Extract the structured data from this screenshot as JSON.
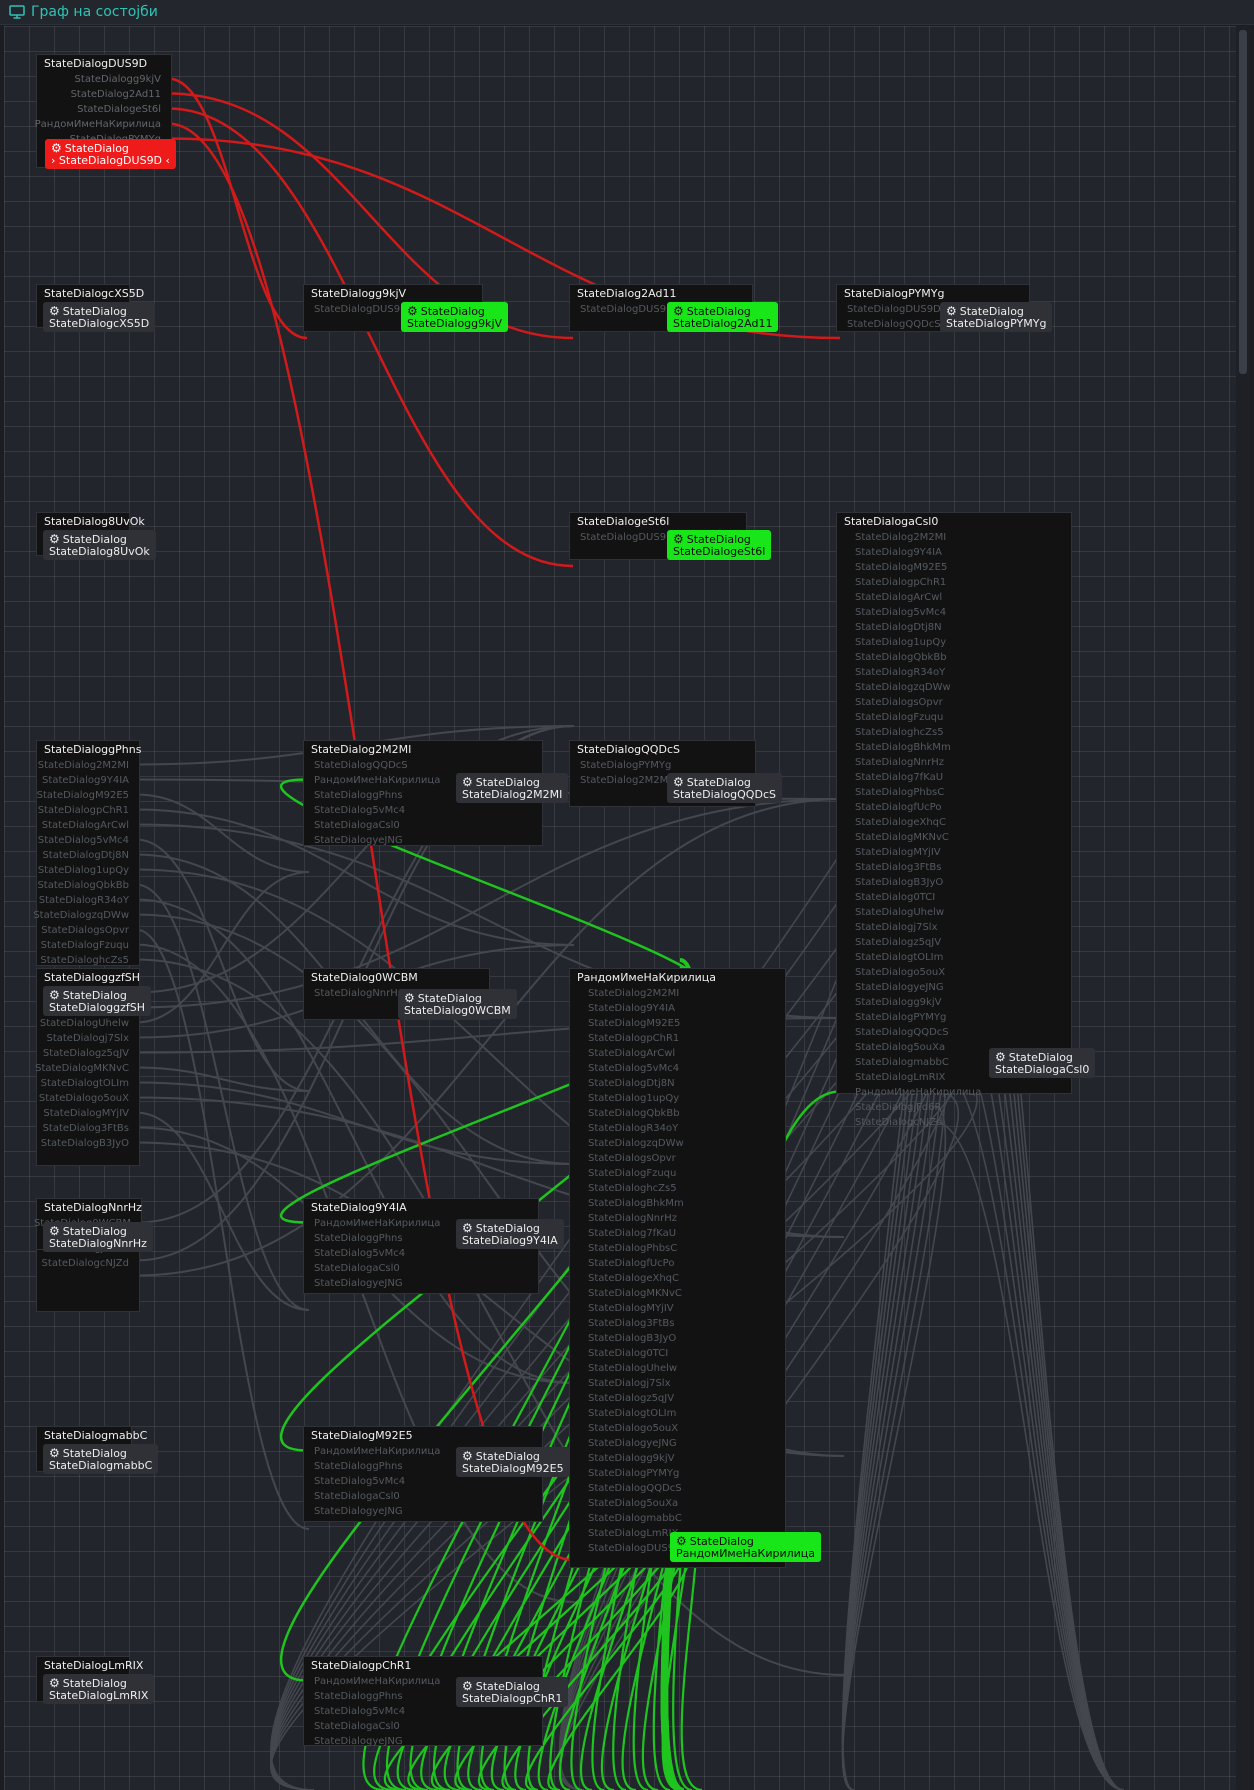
{
  "window": {
    "title": "Граф на состојби"
  },
  "colors": {
    "accent": "#2ec4b6",
    "active_edge": "#d11a1a",
    "reachable_edge": "#1fc41f",
    "idle_edge": "#44474d",
    "current_badge": "#ef1b1b",
    "reachable_badge": "#19e619",
    "idle_badge": "#2f3136"
  },
  "badge_prefix": "StateDialog",
  "nodes": {
    "dus9d": {
      "title": "StateDialogDUS9D",
      "ports": [
        "StateDialogg9kjV",
        "StateDialog2Ad11",
        "StateDialogeSt6l",
        "РандомИмеНаКирилица",
        "StateDialogPYMYg"
      ],
      "badge": "StateDialogDUS9D"
    },
    "xs5d": {
      "title": "StateDialogcXS5D",
      "ports": [],
      "badge": "StateDialogcXS5D"
    },
    "g9kjv": {
      "title": "StateDialogg9kjV",
      "ports": [
        "StateDialogDUS9D"
      ],
      "badge": "StateDialogg9kjV"
    },
    "ad11": {
      "title": "StateDialog2Ad11",
      "ports": [
        "StateDialogDUS9D"
      ],
      "badge": "StateDialog2Ad11"
    },
    "pymyg": {
      "title": "StateDialogPYMYg",
      "ports": [
        "StateDialogDUS9D",
        "StateDialogQQDcS"
      ],
      "badge": "StateDialogPYMYg"
    },
    "uvok": {
      "title": "StateDialog8UvOk",
      "ports": [],
      "badge": "StateDialog8UvOk"
    },
    "est6l": {
      "title": "StateDialogeSt6l",
      "ports": [
        "StateDialogDUS9D"
      ],
      "badge": "StateDialogeSt6l"
    },
    "acsl0": {
      "title": "StateDialogaCsl0",
      "ports": [
        "StateDialog2M2MI",
        "StateDialog9Y4IA",
        "StateDialogM92E5",
        "StateDialogpChR1",
        "StateDialogArCwl",
        "StateDialog5vMc4",
        "StateDialogDtj8N",
        "StateDialog1upQy",
        "StateDialogQbkBb",
        "StateDialogR34oY",
        "StateDialogzqDWw",
        "StateDialogsOpvr",
        "StateDialogFzuqu",
        "StateDialoghcZs5",
        "StateDialogBhkMm",
        "StateDialogNnrHz",
        "StateDialog7fKaU",
        "StateDialogPhbsC",
        "StateDialogfUcPo",
        "StateDialogeXhqC",
        "StateDialogMKNvC",
        "StateDialogMYjIV",
        "StateDialog3FtBs",
        "StateDialogB3JyO",
        "StateDialog0TCI",
        "StateDialogUhelw",
        "StateDialogj7Slx",
        "StateDialogz5qJV",
        "StateDialogtOLIm",
        "StateDialogo5ouX",
        "StateDialogyeJNG",
        "StateDialogg9kjV",
        "StateDialogPYMYg",
        "StateDialogQQDcS",
        "StateDialog5ouXa",
        "StateDialogmabbC",
        "StateDialogLmRIX",
        "РандомИмеНаКирилица",
        "StateDialogjFd6R",
        "StateDialogcNJZd"
      ],
      "badge": "StateDialogaCsl0"
    },
    "phns": {
      "title": "StateDialoggPhns",
      "ports": [
        "StateDialog2M2MI",
        "StateDialog9Y4IA",
        "StateDialogM92E5",
        "StateDialogpChR1",
        "StateDialogArCwl",
        "StateDialog5vMc4",
        "StateDialogDtj8N",
        "StateDialog1upQy",
        "StateDialogQbkBb",
        "StateDialogR34oY",
        "StateDialogzqDWw",
        "StateDialogsOpvr",
        "StateDialogFzuqu",
        "StateDialoghcZs5"
      ],
      "badge": "StateDialoggPhns"
    },
    "phns_tail": {
      "ports": [
        "StateDialogjFd6R",
        "StateDialogcNJZd"
      ]
    },
    "m2mi": {
      "title": "StateDialog2M2MI",
      "ports": [
        "StateDialogQQDcS",
        "РандомИмеНаКирилица",
        "StateDialoggPhns",
        "StateDialog5vMc4",
        "StateDialogaCsl0",
        "StateDialogyeJNG"
      ],
      "badge": "StateDialog2M2MI"
    },
    "qqdcs": {
      "title": "StateDialogQQDcS",
      "ports": [
        "StateDialogPYMYg",
        "StateDialog2M2MI"
      ],
      "badge": "StateDialogQQDcS"
    },
    "gzfsh": {
      "title": "StateDialoggzfSH",
      "ports": [
        "StateDialogo0TCI",
        "StateDialogaCsl0",
        "StateDialogUhelw",
        "StateDialogj7Slx",
        "StateDialogz5qJV",
        "StateDialogMKNvC",
        "StateDialogtOLIm",
        "StateDialogo5ouX",
        "StateDialogMYjIV",
        "StateDialog3FtBs",
        "StateDialogB3JyO"
      ],
      "badge": "StateDialoggzfSH"
    },
    "wcbm": {
      "title": "StateDialog0WCBM",
      "ports": [
        "StateDialogNnrHz"
      ],
      "badge": "StateDialog0WCBM"
    },
    "kir": {
      "title": "РандомИмеНаКирилица",
      "ports": [
        "StateDialog2M2MI",
        "StateDialog9Y4IA",
        "StateDialogM92E5",
        "StateDialogpChR1",
        "StateDialogArCwl",
        "StateDialog5vMc4",
        "StateDialogDtj8N",
        "StateDialog1upQy",
        "StateDialogQbkBb",
        "StateDialogR34oY",
        "StateDialogzqDWw",
        "StateDialogsOpvr",
        "StateDialogFzuqu",
        "StateDialoghcZs5",
        "StateDialogBhkMm",
        "StateDialogNnrHz",
        "StateDialog7fKaU",
        "StateDialogPhbsC",
        "StateDialogfUcPo",
        "StateDialogeXhqC",
        "StateDialogMKNvC",
        "StateDialogMYjIV",
        "StateDialog3FtBs",
        "StateDialogB3JyO",
        "StateDialog0TCI",
        "StateDialogUhelw",
        "StateDialogj7Slx",
        "StateDialogz5qJV",
        "StateDialogtOLIm",
        "StateDialogo5ouX",
        "StateDialogyeJNG",
        "StateDialogg9kjV",
        "StateDialogPYMYg",
        "StateDialogQQDcS",
        "StateDialog5ouXa",
        "StateDialogmabbC",
        "StateDialogLmRIX",
        "StateDialogDUS9D"
      ],
      "badge": "РандомИмеНаКирилица"
    },
    "nnrhz": {
      "title": "StateDialogNnrHz",
      "ports": [
        "StateDialog0WCBM"
      ],
      "badge": "StateDialogNnrHz"
    },
    "y4ia": {
      "title": "StateDialog9Y4IA",
      "ports": [
        "РандомИмеНаКирилица",
        "StateDialoggPhns",
        "StateDialog5vMc4",
        "StateDialogaCsl0",
        "StateDialogyeJNG"
      ],
      "badge": "StateDialog9Y4IA"
    },
    "mabbc": {
      "title": "StateDialogmabbC",
      "ports": [],
      "badge": "StateDialogmabbC"
    },
    "m92e5": {
      "title": "StateDialogM92E5",
      "ports": [
        "РандомИмеНаКирилица",
        "StateDialoggPhns",
        "StateDialog5vMc4",
        "StateDialogaCsl0",
        "StateDialogyeJNG"
      ],
      "badge": "StateDialogM92E5"
    },
    "lmrix": {
      "title": "StateDialogLmRIX",
      "ports": [],
      "badge": "StateDialogLmRIX"
    },
    "pchr1": {
      "title": "StateDialogpChR1",
      "ports": [
        "РандомИмеНаКирилица",
        "StateDialoggPhns",
        "StateDialog5vMc4",
        "StateDialogaCsl0",
        "StateDialogyeJNG"
      ],
      "badge": "StateDialogpChR1"
    }
  }
}
